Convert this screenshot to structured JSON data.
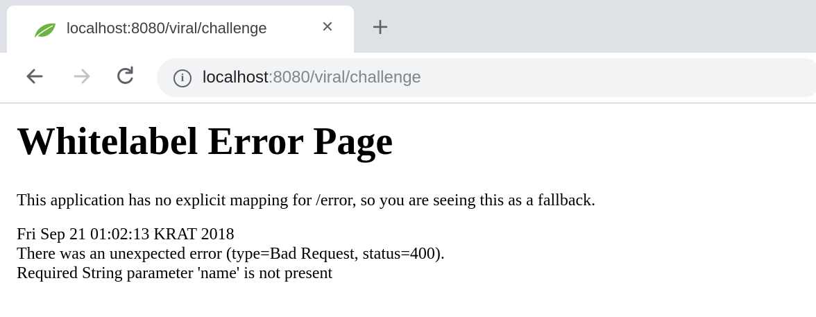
{
  "tab": {
    "title": "localhost:8080/viral/challenge",
    "close_icon": "close-icon",
    "favicon": "spring-leaf-icon",
    "new_tab_icon": "plus-icon"
  },
  "toolbar": {
    "back_icon": "arrow-left-icon",
    "forward_icon": "arrow-right-icon",
    "reload_icon": "reload-icon",
    "info_icon": "info-icon",
    "url_host": "localhost",
    "url_rest": ":8080/viral/challenge"
  },
  "page": {
    "heading": "Whitelabel Error Page",
    "message": "This application has no explicit mapping for /error, so you are seeing this as a fallback.",
    "timestamp": "Fri Sep 21 01:02:13 KRAT 2018",
    "error_line": "There was an unexpected error (type=Bad Request, status=400).",
    "detail_line": "Required String parameter 'name' is not present"
  },
  "colors": {
    "tab_strip": "#dee1e6",
    "omnibox": "#f1f3f4",
    "favicon_green": "#6db33f"
  }
}
